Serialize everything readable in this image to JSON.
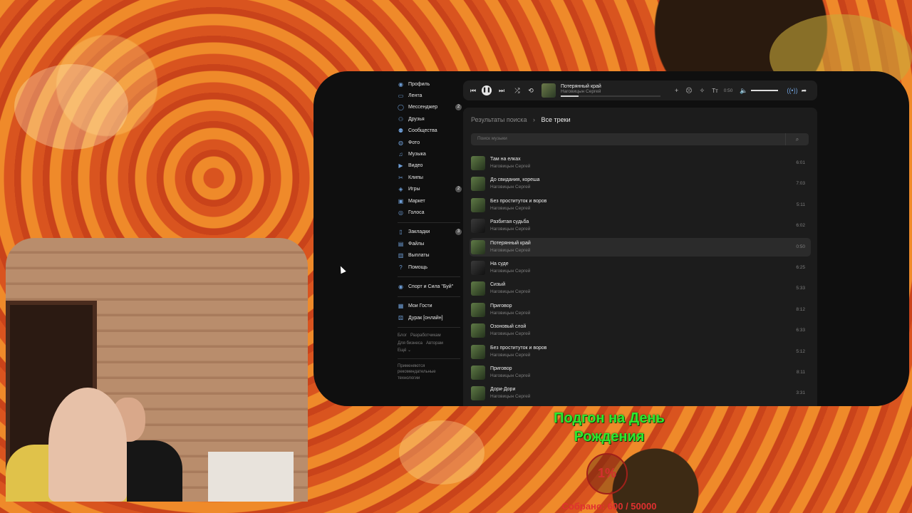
{
  "sidebar": {
    "items": [
      {
        "label": "Профиль",
        "icon": "user-icon"
      },
      {
        "label": "Лента",
        "icon": "feed-icon"
      },
      {
        "label": "Мессенджер",
        "icon": "messenger-icon",
        "badge": "2"
      },
      {
        "label": "Друзья",
        "icon": "friends-icon"
      },
      {
        "label": "Сообщества",
        "icon": "communities-icon"
      },
      {
        "label": "Фото",
        "icon": "photo-icon"
      },
      {
        "label": "Музыка",
        "icon": "music-icon"
      },
      {
        "label": "Видео",
        "icon": "video-icon"
      },
      {
        "label": "Клипы",
        "icon": "clips-icon"
      },
      {
        "label": "Игры",
        "icon": "games-icon",
        "badge": "2"
      },
      {
        "label": "Маркет",
        "icon": "market-icon"
      },
      {
        "label": "Голоса",
        "icon": "votes-icon"
      }
    ],
    "items2": [
      {
        "label": "Закладки",
        "icon": "bookmarks-icon",
        "badge": "3"
      },
      {
        "label": "Файлы",
        "icon": "files-icon"
      },
      {
        "label": "Выплаты",
        "icon": "payouts-icon"
      },
      {
        "label": "Помощь",
        "icon": "help-icon"
      }
    ],
    "group": "Спорт и Сила \"Буй\"",
    "apps": [
      "Мои Гости",
      "Дурак [онлайн]"
    ],
    "footer": [
      "Блог",
      "Разработчикам",
      "Для бизнеса",
      "Авторам",
      "Ещё"
    ],
    "footer_note": "Применяются рекомендательные технологии"
  },
  "player": {
    "title": "Потерянный край",
    "artist": "Наговицын Сергей",
    "time": "0:50",
    "progress": 0.18
  },
  "content": {
    "breadcrumb_parent": "Результаты поиска",
    "breadcrumb_current": "Все треки",
    "search_placeholder": "Поиск музыки",
    "tracks": [
      {
        "title": "Там на елках",
        "artist": "Наговицын Сергей",
        "duration": "6:01"
      },
      {
        "title": "До свидания, кореша",
        "artist": "Наговицын Сергей",
        "duration": "7:03"
      },
      {
        "title": "Без проституток и воров",
        "artist": "Наговицын Сергей",
        "duration": "5:11"
      },
      {
        "title": "Разбитая судьба",
        "artist": "Наговицын Сергей",
        "duration": "6:02"
      },
      {
        "title": "Потерянный край",
        "artist": "Наговицын Сергей",
        "duration": "0:50"
      },
      {
        "title": "На суде",
        "artist": "Наговицын Сергей",
        "duration": "6:25"
      },
      {
        "title": "Сизый",
        "artist": "Наговицын Сергей",
        "duration": "5:33"
      },
      {
        "title": "Приговор",
        "artist": "Наговицын Сергей",
        "duration": "8:12"
      },
      {
        "title": "Озоновый слой",
        "artist": "Наговицын Сергей",
        "duration": "6:33"
      },
      {
        "title": "Без проституток и воров",
        "artist": "Наговицын Сергей",
        "duration": "5:12"
      },
      {
        "title": "Приговор",
        "artist": "Наговицын Сергей",
        "duration": "8:11"
      },
      {
        "title": "Дори-Дори",
        "artist": "Наговицын Сергей",
        "duration": "3:31"
      }
    ]
  },
  "overlay": {
    "goal_title": "Подгон на День Рождения",
    "percent": "1%",
    "collected": "Собрано: 600 / 50000"
  },
  "colors": {
    "accent": "#6f9fd8",
    "goal_green": "#2ee82e",
    "goal_red": "#d32f2f"
  }
}
